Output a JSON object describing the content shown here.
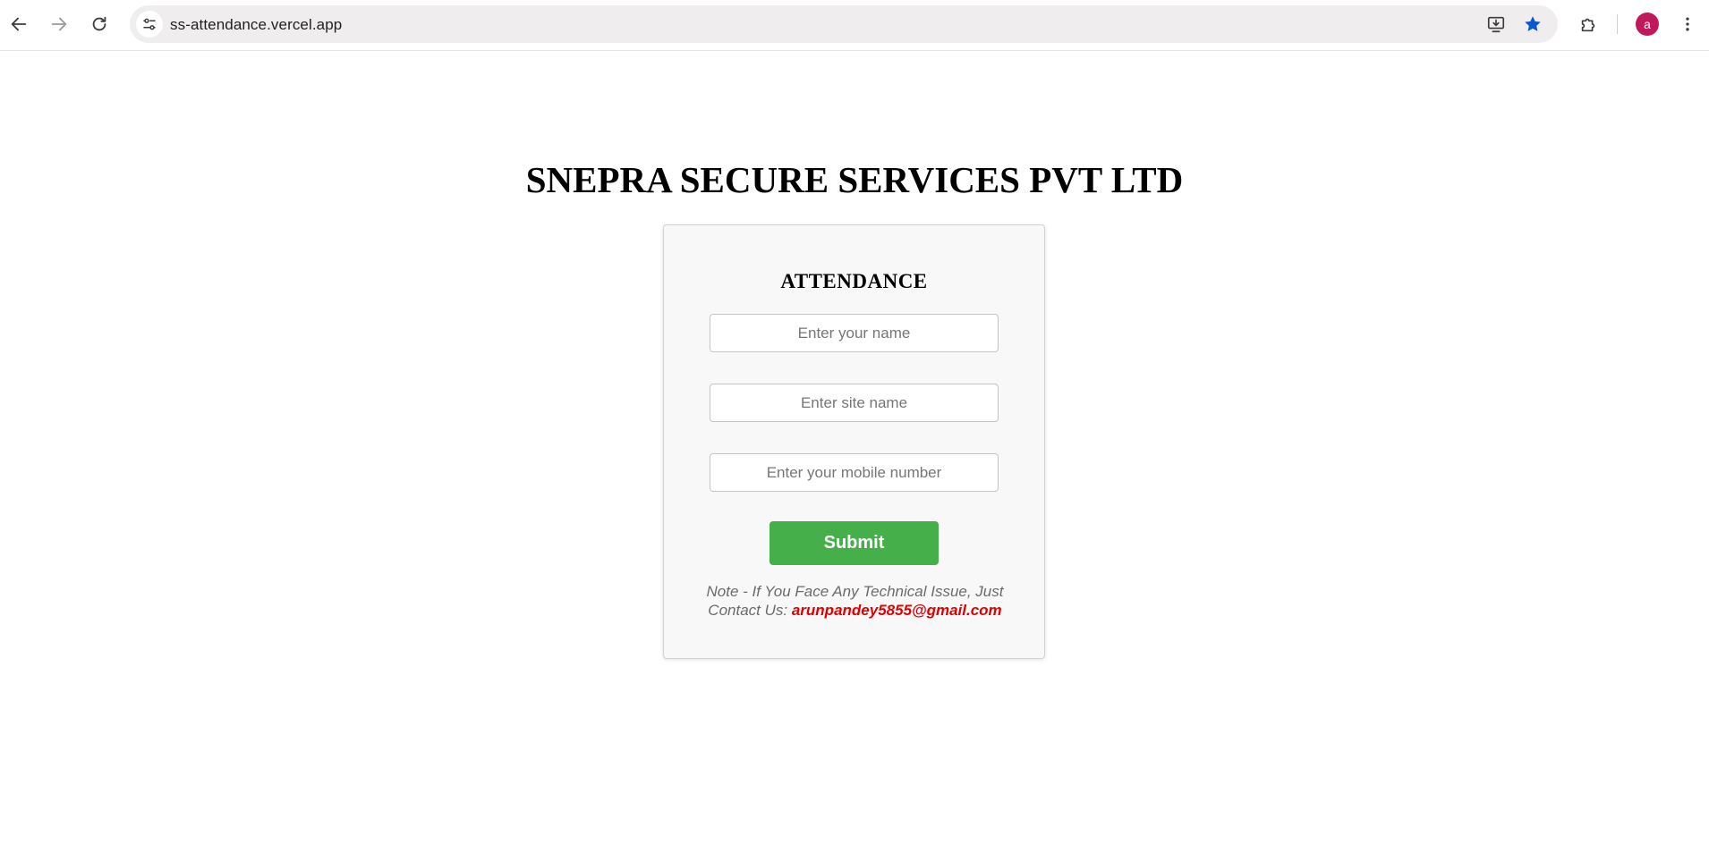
{
  "browser": {
    "url": "ss-attendance.vercel.app",
    "profile_initial": "a",
    "profile_color": "#c2185b",
    "star_color": "#0b57d0",
    "icons": {
      "back": "arrow-left-icon",
      "forward": "arrow-right-icon",
      "reload": "reload-icon",
      "site_info": "tune-icon",
      "install": "install-app-icon",
      "bookmark": "star-icon",
      "extensions": "puzzle-icon",
      "menu": "more-vert-icon"
    }
  },
  "page": {
    "title": "SNEPRA SECURE SERVICES PVT LTD"
  },
  "form": {
    "heading": "ATTENDANCE",
    "name_placeholder": "Enter your name",
    "site_placeholder": "Enter site name",
    "mobile_placeholder": "Enter your mobile number",
    "submit_label": "Submit",
    "submit_color": "#45b049",
    "note_text": "Note - If You Face Any Technical Issue, Just Contact Us: ",
    "contact_email": "arunpandey5855@gmail.com",
    "email_color": "#e00000"
  }
}
